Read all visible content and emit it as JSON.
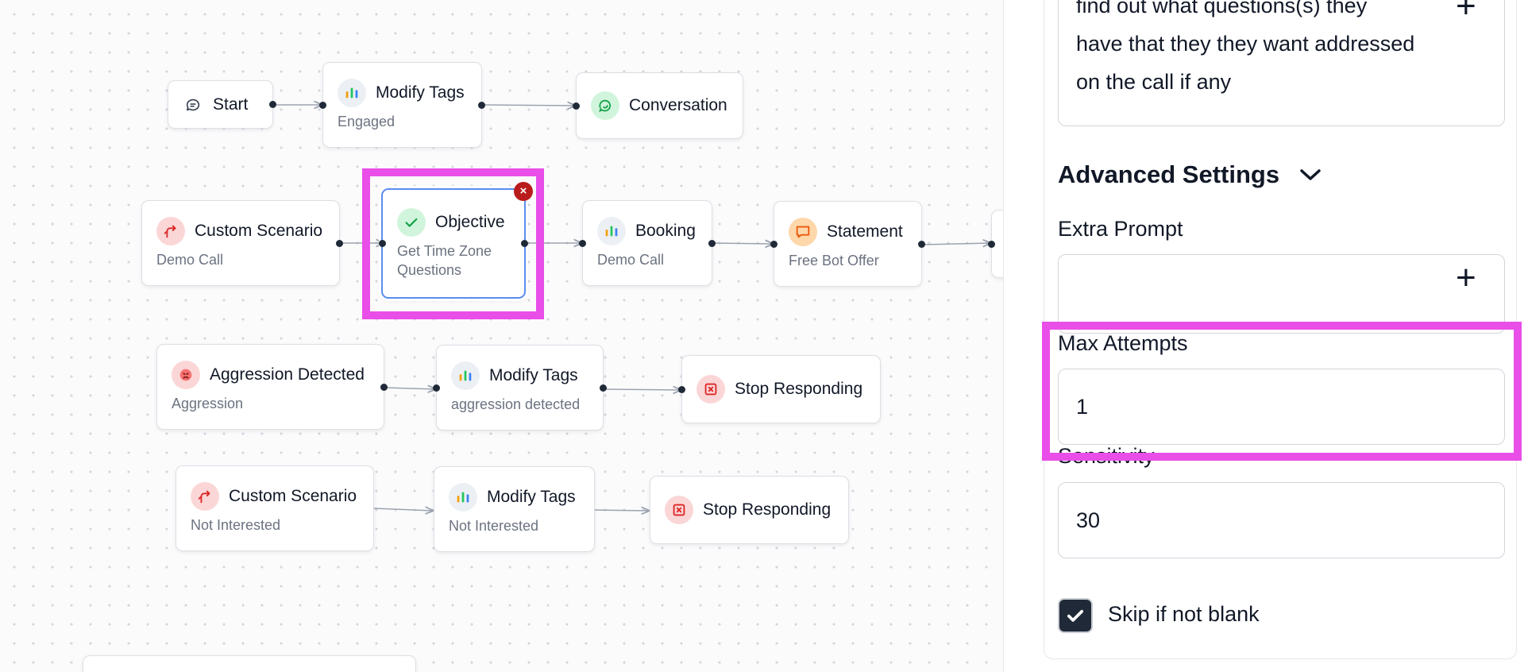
{
  "canvas": {
    "nodes": {
      "start": {
        "title": "Start",
        "icon": "chat-bubble-icon"
      },
      "modify_tags_1": {
        "title": "Modify Tags",
        "subtitle": "Engaged",
        "icon": "tag-chart-icon"
      },
      "conversation": {
        "title": "Conversation",
        "icon": "conversation-icon"
      },
      "custom_scenario_1": {
        "title": "Custom Scenario",
        "subtitle": "Demo Call",
        "icon": "branch-arrow-icon"
      },
      "objective": {
        "title": "Objective",
        "subtitle_line1": "Get Time Zone",
        "subtitle_line2": "Questions",
        "icon": "check-icon",
        "delete_symbol": "×"
      },
      "booking": {
        "title": "Booking",
        "subtitle": "Demo Call",
        "icon": "tag-chart-icon"
      },
      "statement": {
        "title": "Statement",
        "subtitle": "Free Bot Offer",
        "icon": "speech-bubble-icon"
      },
      "aggression": {
        "title": "Aggression Detected",
        "subtitle": "Aggression",
        "icon": "angry-face-icon"
      },
      "modify_tags_2": {
        "title": "Modify Tags",
        "subtitle": "aggression detected",
        "icon": "tag-chart-icon"
      },
      "stop_1": {
        "title": "Stop Responding",
        "icon": "stop-square-icon"
      },
      "custom_scenario_2": {
        "title": "Custom Scenario",
        "subtitle": "Not Interested",
        "icon": "branch-arrow-icon"
      },
      "modify_tags_3": {
        "title": "Modify Tags",
        "subtitle": "Not Interested",
        "icon": "tag-chart-icon"
      },
      "stop_2": {
        "title": "Stop Responding",
        "icon": "stop-square-icon"
      }
    }
  },
  "panel": {
    "description_lines": [
      "find out what questions(s) they",
      "have that they they want addressed",
      "on the call if any"
    ],
    "add_symbol": "+",
    "advanced_settings": {
      "title": "Advanced Settings"
    },
    "extra_prompt": {
      "label": "Extra Prompt",
      "value": ""
    },
    "max_attempts": {
      "label": "Max Attempts",
      "value": "1"
    },
    "sensitivity": {
      "label": "Sensitivity",
      "value": "30"
    },
    "skip_if_not_blank": {
      "label": "Skip if not blank",
      "checked": true
    }
  },
  "colors": {
    "highlight": "#e94ee8",
    "selected_border": "#5b8def",
    "delete_badge": "#b91c1c"
  }
}
